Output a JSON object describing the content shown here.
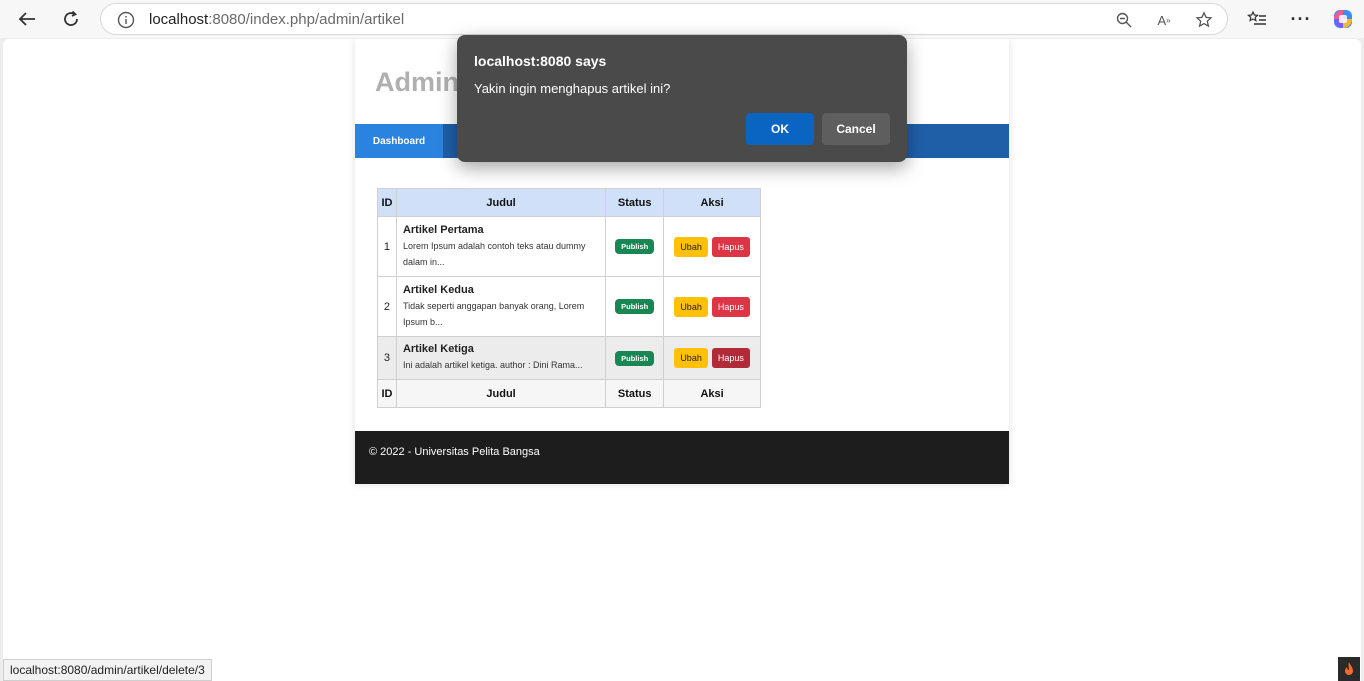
{
  "browser": {
    "url_host": "localhost",
    "url_rest": ":8080/index.php/admin/artikel",
    "status_url": "localhost:8080/admin/artikel/delete/3"
  },
  "page": {
    "title": "Admin",
    "nav": {
      "dashboard": "Dashboard"
    },
    "table": {
      "headers": {
        "id": "ID",
        "judul": "Judul",
        "status": "Status",
        "aksi": "Aksi"
      },
      "rows": [
        {
          "id": "1",
          "title": "Artikel Pertama",
          "snippet": "Lorem Ipsum adalah contoh teks atau dummy dalam in...",
          "status": "Publish",
          "edit": "Ubah",
          "delete": "Hapus"
        },
        {
          "id": "2",
          "title": "Artikel Kedua",
          "snippet": "Tidak seperti anggapan banyak orang, Lorem Ipsum b...",
          "status": "Publish",
          "edit": "Ubah",
          "delete": "Hapus"
        },
        {
          "id": "3",
          "title": "Artikel Ketiga",
          "snippet": "Ini adalah artikel ketiga. author : Dini Rama...",
          "status": "Publish",
          "edit": "Ubah",
          "delete": "Hapus"
        }
      ]
    },
    "footer": "© 2022 - Universitas Pelita Bangsa"
  },
  "dialog": {
    "title": "localhost:8080 says",
    "message": "Yakin ingin menghapus artikel ini?",
    "ok": "OK",
    "cancel": "Cancel"
  },
  "icons": [
    "back-arrow-icon",
    "refresh-icon",
    "info-icon",
    "zoom-out-icon",
    "read-aloud-icon",
    "favorite-star-icon",
    "favorites-list-icon",
    "more-icon",
    "copilot-icon",
    "flame-icon"
  ],
  "colors": {
    "nav": "#1f5fa8",
    "nav_active": "#2b83e0",
    "publish": "#198754",
    "edit": "#ffc107",
    "delete": "#dc3545",
    "ok": "#0a64c2"
  }
}
